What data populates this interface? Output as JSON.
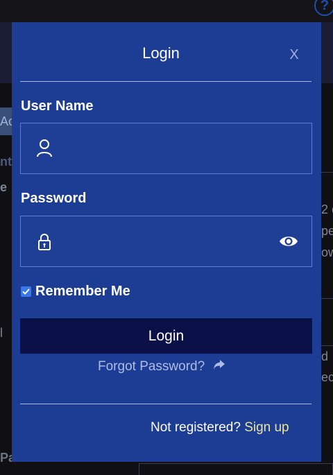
{
  "background": {
    "help_glyph": "?",
    "fragment_left_1": "Acc",
    "fragment_left_2": "nt",
    "fragment_left_3": "e",
    "fragment_left_4": "l",
    "fragment_right_1": "2 c",
    "fragment_right_2": "pe",
    "fragment_right_3": "ow",
    "fragment_right_4": "d",
    "fragment_right_5": "ec",
    "fragment_bottom": "Password"
  },
  "modal": {
    "title": "Login",
    "close_label": "X",
    "username": {
      "label": "User Name",
      "value": "",
      "placeholder": "",
      "icon": "user-icon"
    },
    "password": {
      "label": "Password",
      "value": "",
      "placeholder": "",
      "icon": "lock-icon",
      "toggle_icon": "eye-icon"
    },
    "remember_me": {
      "label": "Remember Me",
      "checked": true
    },
    "login_button": "Login",
    "forgot_password": "Forgot Password?",
    "footer": {
      "prompt": "Not registered?",
      "signup_link": "Sign up"
    }
  },
  "colors": {
    "modal_bg": "#1d3c93",
    "login_button_bg": "#0b1148",
    "signup_link": "#e8e59b",
    "checkbox": "#3a78e6"
  }
}
